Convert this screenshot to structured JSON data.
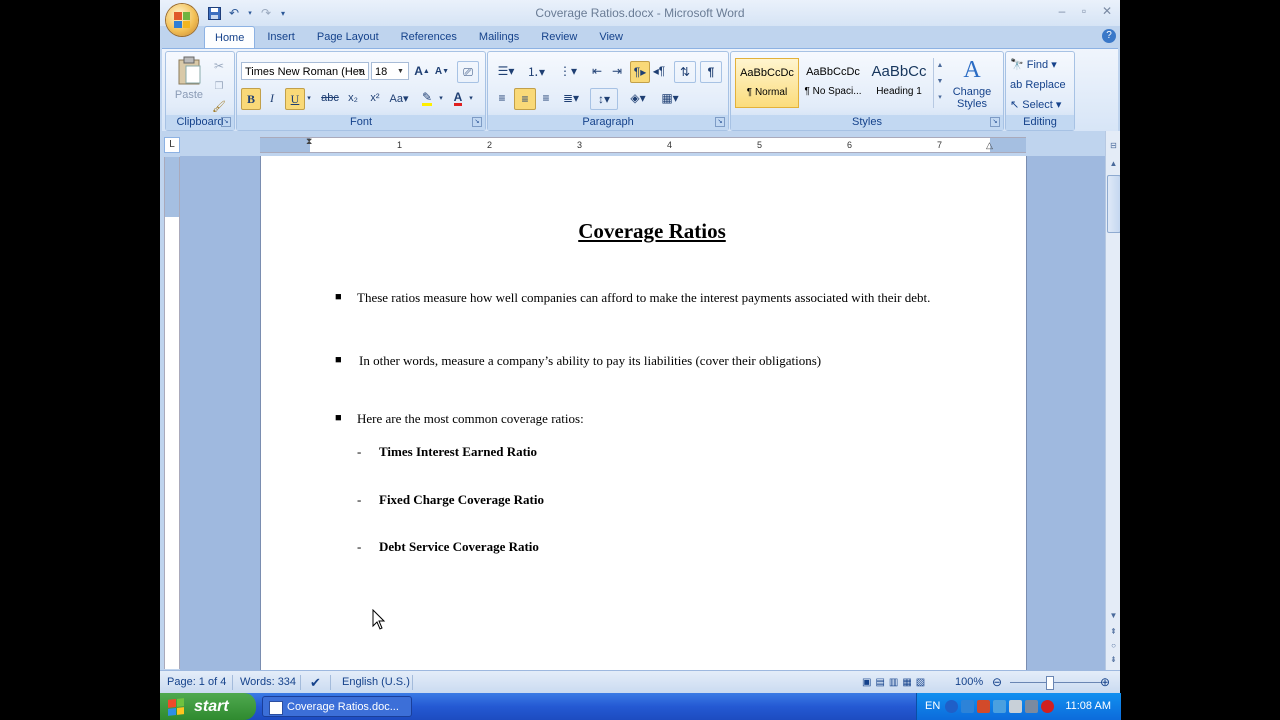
{
  "window": {
    "title": "Coverage Ratios.docx - Microsoft Word"
  },
  "tabs": [
    "Home",
    "Insert",
    "Page Layout",
    "References",
    "Mailings",
    "Review",
    "View"
  ],
  "ribbon": {
    "clipboard": {
      "label": "Clipboard",
      "paste": "Paste"
    },
    "font": {
      "label": "Font",
      "font_name": "Times New Roman (Hea",
      "font_size": "18"
    },
    "paragraph": {
      "label": "Paragraph"
    },
    "styles": {
      "label": "Styles",
      "items": [
        {
          "sample": "AaBbCcDc",
          "name": "¶ Normal"
        },
        {
          "sample": "AaBbCcDc",
          "name": "¶ No Spaci..."
        },
        {
          "sample": "AaBbCc",
          "name": "Heading 1"
        }
      ],
      "change_styles": "Change Styles"
    },
    "editing": {
      "label": "Editing",
      "find": "Find",
      "replace": "Replace",
      "select": "Select"
    }
  },
  "ruler": {
    "numbers": [
      "1",
      "2",
      "3",
      "4",
      "5",
      "6",
      "7"
    ]
  },
  "document": {
    "title": "Coverage Ratios",
    "bullets": [
      "These ratios measure how well companies can afford to make the interest payments associated with their debt.",
      "In other words, measure a company’s ability to pay its liabilities (cover their obligations)",
      "Here are the most common coverage ratios:"
    ],
    "sub_items": [
      "Times Interest Earned Ratio",
      "Fixed Charge Coverage Ratio",
      "Debt Service Coverage Ratio"
    ]
  },
  "status": {
    "page": "Page: 1 of 4",
    "words": "Words: 334",
    "language": "English (U.S.)",
    "zoom": "100%"
  },
  "taskbar": {
    "start": "start",
    "task_button": "Coverage Ratios.doc...",
    "lang": "EN",
    "clock": "11:08 AM"
  },
  "colors": {
    "accent": "#15428b",
    "ribbon": "#d7e5f7",
    "taskbar": "#2459d3"
  }
}
